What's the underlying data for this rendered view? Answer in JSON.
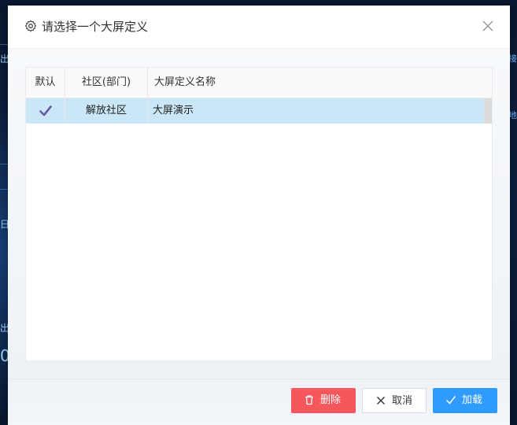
{
  "background": {
    "labels": [
      "出",
      "日",
      "出",
      "0"
    ],
    "right_label_1": "接",
    "right_label_2": "地"
  },
  "dialog": {
    "title": "请选择一个大屏定义",
    "title_icon": "gear-icon",
    "close_icon": "close-icon"
  },
  "table": {
    "headers": {
      "default": "默认",
      "community": "社区(部门)",
      "name": "大屏定义名称"
    },
    "rows": [
      {
        "default": "✔",
        "community": "解放社区",
        "name": "大屏演示"
      }
    ],
    "selected_row_color": "#c9e7f7"
  },
  "footer": {
    "delete_label": "删除",
    "cancel_label": "取消",
    "load_label": "加载"
  },
  "colors": {
    "delete": "#f5575c",
    "load": "#2f9bff",
    "check": "#6a5aa6"
  }
}
